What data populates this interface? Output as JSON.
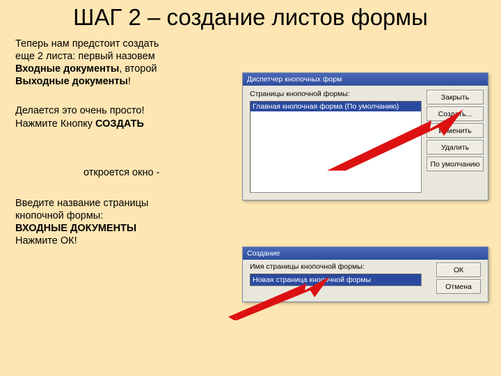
{
  "title": "ШАГ 2 – создание листов формы",
  "p1": {
    "t1": "Теперь нам предстоит создать",
    "t2": "еще 2 листа: первый назовем",
    "t3": "Входные документы",
    "t4": ", второй",
    "t5": "Выходные документы",
    "t6": "!"
  },
  "p2": {
    "t1": "Делается это очень просто!",
    "t2": "Нажмите Кнопку ",
    "t3": "СОЗДАТЬ"
  },
  "p3": {
    "t1": "откроется окно -"
  },
  "p4": {
    "t1": "Введите название страницы",
    "t2": "кнопочной формы:",
    "t3": "ВХОДНЫЕ ДОКУМЕНТЫ",
    "t4": "Нажмите ОК!"
  },
  "dlg1": {
    "title": "Диспетчер кнопочных форм",
    "label": "Страницы кнопочной формы:",
    "item": "Главная кнопочная форма (По умолчанию)",
    "btn": {
      "close": "Закрыть",
      "create": "Создать...",
      "edit": "Изменить",
      "delete": "Удалить",
      "default": "По умолчанию"
    }
  },
  "dlg2": {
    "title": "Создание",
    "label": "Имя страницы кнопочной формы:",
    "value": "Новая страница кнопочной формы",
    "btn": {
      "ok": "ОК",
      "cancel": "Отмена"
    }
  }
}
